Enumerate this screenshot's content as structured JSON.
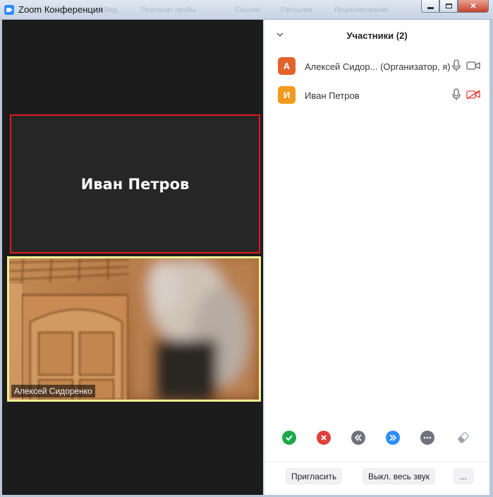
{
  "window": {
    "title": "Zoom Конференция",
    "background_menu_ghost": [
      "Вид",
      "Результат пробы",
      "Ссылки",
      "Рассылки",
      "Рецензирование"
    ]
  },
  "video": {
    "speaker_tile": {
      "name": "Иван Петров",
      "border_color": "#e11b1b"
    },
    "self_tile": {
      "name": "Алексей Сидоренко",
      "border_color": "#f2ef93"
    }
  },
  "panel": {
    "title": "Участники (2)",
    "participants": [
      {
        "initial": "А",
        "name": "Алексей Сидор... (Организатор, я)",
        "avatar_color": "#e2632b",
        "mic": "mic-icon",
        "video": "video-on-icon"
      },
      {
        "initial": "И",
        "name": "Иван Петров",
        "avatar_color": "#f29a1d",
        "mic": "mic-icon",
        "video": "video-off-icon"
      }
    ],
    "reactions": [
      {
        "name": "yes-icon",
        "color": "#1ea84a"
      },
      {
        "name": "no-icon",
        "color": "#e0403c"
      },
      {
        "name": "slower-icon",
        "color": "#6e737c"
      },
      {
        "name": "faster-icon",
        "color": "#2d8cff"
      },
      {
        "name": "more-reactions-icon",
        "color": "#6e737c"
      },
      {
        "name": "clear-all-icon",
        "color": "#9aa0a6"
      }
    ],
    "footer": {
      "invite_label": "Пригласить",
      "mute_all_label": "Выкл. весь звук",
      "more_label": "..."
    }
  }
}
